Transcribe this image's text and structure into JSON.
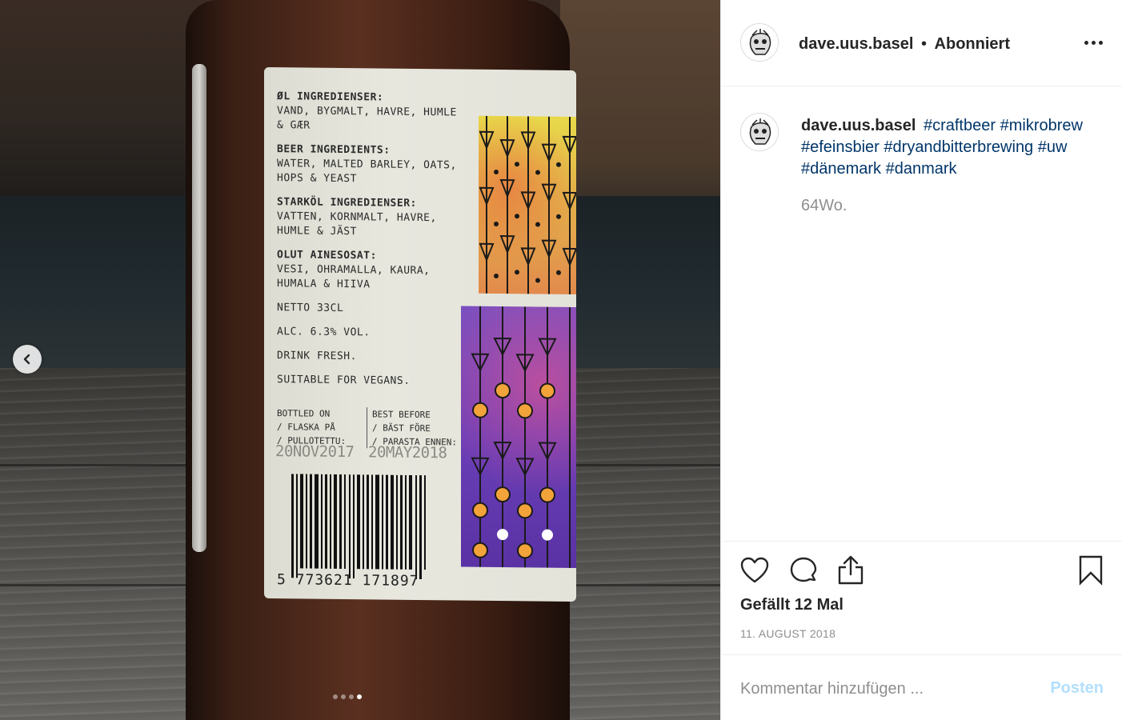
{
  "post": {
    "username": "dave.uus.basel",
    "separator": "•",
    "follow_status": "Abonniert",
    "caption": {
      "username": "dave.uus.basel",
      "hashtags": [
        "#craftbeer",
        "#mikrobrew",
        "#efeinsbier",
        "#dryandbitterbrewing",
        "#uw",
        "#dänemark",
        "#danmark"
      ]
    },
    "age": "64Wo.",
    "likes": "Gefällt 12 Mal",
    "date": "11. AUGUST 2018",
    "comment_placeholder": "Kommentar hinzufügen ...",
    "post_button": "Posten"
  },
  "icons": {
    "more": "more-options-icon",
    "like": "heart-icon",
    "comment": "comment-icon",
    "share": "share-icon",
    "save": "bookmark-icon",
    "prev": "chevron-left-icon"
  },
  "carousel": {
    "slides": 4,
    "active_index": 3
  },
  "colors": {
    "hashtag": "#003569",
    "muted": "#8e8e8e",
    "post_disabled": "#b2dffc",
    "text": "#262626"
  },
  "photo_label": {
    "sections": [
      {
        "heading": "ØL INGREDIENSER:",
        "lines": [
          "VAND, BYGMALT, HAVRE, HUMLE",
          "& GÆR"
        ]
      },
      {
        "heading": "BEER INGREDIENTS:",
        "lines": [
          "WATER, MALTED BARLEY, OATS,",
          "HOPS & YEAST"
        ]
      },
      {
        "heading": "STARKÖL INGREDIENSER:",
        "lines": [
          "VATTEN, KORNMALT, HAVRE,",
          "HUMLE & JÄST"
        ]
      },
      {
        "heading": "OLUT AINESOSAT:",
        "lines": [
          "VESI, OHRAMALLA, KAURA,",
          "HUMALA & HIIVA"
        ]
      }
    ],
    "netto": "NETTO 33CL",
    "alc": "ALC. 6.3% VOL.",
    "drink": "DRINK FRESH.",
    "vegans": "SUITABLE FOR VEGANS.",
    "bottled_lines": [
      "BOTTLED ON",
      "/ FLASKA PÅ",
      "/ PULLOTETTU:"
    ],
    "best_before_lines": [
      "BEST BEFORE",
      "/ BÄST FÖRE",
      "/ PARASTA ENNEN:"
    ],
    "bottled_date": "20NOV2017",
    "best_before_date": "20MAY2018",
    "barcode": "5 773621 171897"
  }
}
